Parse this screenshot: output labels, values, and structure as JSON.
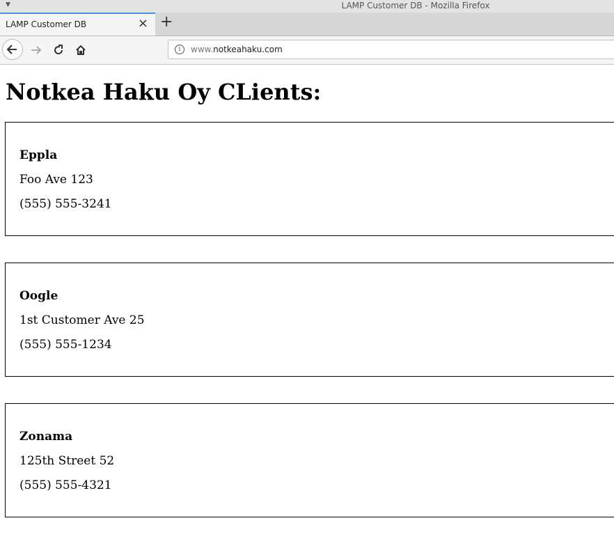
{
  "window": {
    "title": "LAMP Customer DB - Mozilla Firefox"
  },
  "browser": {
    "tab_label": "LAMP Customer DB",
    "url_prefix": "www.",
    "url_domain": "notkeahaku.com",
    "icons": [
      "back-arrow-icon",
      "forward-arrow-icon",
      "reload-icon",
      "home-icon",
      "info-icon",
      "close-icon",
      "plus-icon"
    ]
  },
  "page": {
    "heading": "Notkea Haku Oy CLients:",
    "clients": [
      {
        "name": "Eppla",
        "address": "Foo Ave 123",
        "phone": "(555) 555-3241"
      },
      {
        "name": "Oogle",
        "address": "1st Customer Ave 25",
        "phone": "(555) 555-1234"
      },
      {
        "name": "Zonama",
        "address": "125th Street 52",
        "phone": "(555) 555-4321"
      }
    ]
  }
}
